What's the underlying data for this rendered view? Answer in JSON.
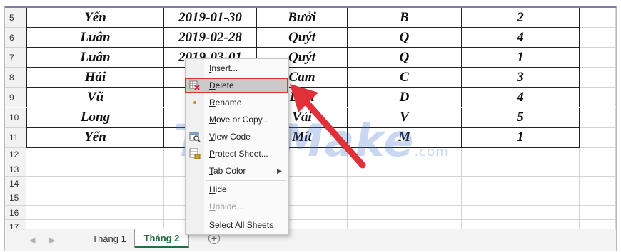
{
  "rows": [
    {
      "num": "5",
      "name": "Yến",
      "date": "2019-01-30",
      "fruit": "Bưởi",
      "code": "B",
      "qty": "2"
    },
    {
      "num": "6",
      "name": "Luân",
      "date": "2019-02-28",
      "fruit": "Quýt",
      "code": "Q",
      "qty": "4"
    },
    {
      "num": "7",
      "name": "Luân",
      "date": "2019-03-01",
      "fruit": "Quýt",
      "code": "Q",
      "qty": "1"
    },
    {
      "num": "8",
      "name": "Hải",
      "date": "20",
      "fruit": "Cam",
      "code": "C",
      "qty": "3"
    },
    {
      "num": "9",
      "name": "Vũ",
      "date": "20",
      "fruit": "Dưa",
      "code": "D",
      "qty": "4"
    },
    {
      "num": "10",
      "name": "Long",
      "date": "20",
      "fruit": "Vải",
      "code": "V",
      "qty": "5"
    },
    {
      "num": "11",
      "name": "Yến",
      "date": "20",
      "fruit": "Mít",
      "code": "M",
      "qty": "1"
    }
  ],
  "empty_rows": [
    "12",
    "13",
    "14",
    "15",
    "16",
    "17"
  ],
  "context_menu": {
    "insert": "Insert...",
    "delete": "Delete",
    "rename": "Rename",
    "move_copy": "Move or Copy...",
    "view_code": "View Code",
    "protect_sheet": "Protect Sheet...",
    "tab_color": "Tab Color",
    "hide": "Hide",
    "unhide": "Unhide...",
    "select_all_sheets": "Select All Sheets"
  },
  "sheet_tabs": [
    "Tháng 1",
    "Tháng 2"
  ],
  "active_tab": "Tháng 2",
  "watermark": {
    "main": "TipsMake",
    "suffix": ".com"
  },
  "colors": {
    "highlight": "#e0303a",
    "arrow": "#e0303a",
    "active_tab": "#1e7145"
  }
}
